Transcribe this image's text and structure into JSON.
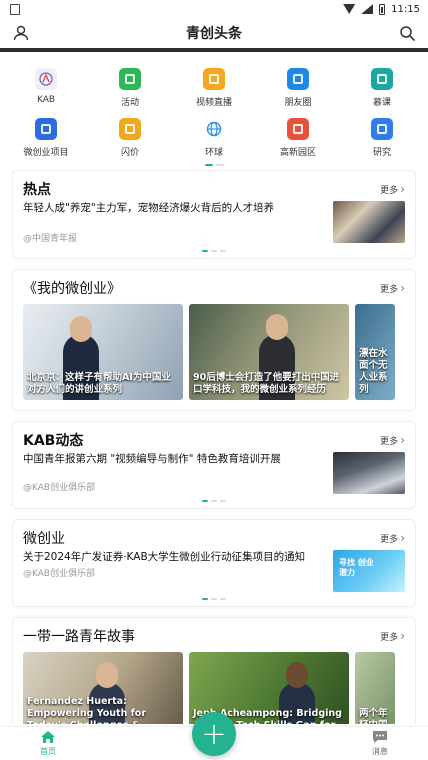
{
  "status": {
    "time": "11:15"
  },
  "header": {
    "title": "青创头条"
  },
  "grid": [
    {
      "label": "KAB",
      "icon": "kab-logo-icon",
      "color": "#f1eef8",
      "glyph": ""
    },
    {
      "label": "活动",
      "icon": "gift-icon",
      "color": "#2fb657",
      "glyph": ""
    },
    {
      "label": "视频直播",
      "icon": "video-camera-icon",
      "color": "#f6a623",
      "glyph": ""
    },
    {
      "label": "朋友圈",
      "icon": "pinwheel-icon",
      "color": "#1e88e5",
      "glyph": ""
    },
    {
      "label": "慕课",
      "icon": "mooc-screen-icon",
      "color": "#1da7a0",
      "glyph": ""
    },
    {
      "label": "微创业项目",
      "icon": "server-stack-icon",
      "color": "#2d6be0",
      "glyph": ""
    },
    {
      "label": "闪价",
      "icon": "money-bag-icon",
      "color": "#f0a81c",
      "glyph": ""
    },
    {
      "label": "环球",
      "icon": "globe-icon",
      "color": "#ffffff",
      "glyph": ""
    },
    {
      "label": "高新园区",
      "icon": "park-building-icon",
      "color": "#e5533c",
      "glyph": ""
    },
    {
      "label": "研究",
      "icon": "research-card-icon",
      "color": "#2f7de9",
      "glyph": ""
    }
  ],
  "sections": {
    "hot": {
      "title": "热点",
      "more": "更多",
      "news_title": "年轻人成\"养宠\"主力军，宠物经济爆火背后的人才培养",
      "source": "@中国青年报"
    },
    "my_startup": {
      "title": "《我的微创业》",
      "more": "更多",
      "tiles": [
        {
          "caption": "北京京：这样子有帮助AI为中国业对方人们的讲创业系列"
        },
        {
          "caption": "90后博士会打造了他要打出中国进口学科技，我的微创业系列经历"
        },
        {
          "caption": "漂在水面个无人业系列"
        }
      ]
    },
    "kab": {
      "title": "KAB动态",
      "more": "更多",
      "news_title": "中国青年报第六期 \"视频编导与制作\" 特色教育培训开展",
      "source": "@KAB创业俱乐部"
    },
    "micro": {
      "title": "微创业",
      "more": "更多",
      "news_title": "关于2024年广发证券·KAB大学生微创业行动征集项目的通知",
      "source": "@KAB创业俱乐部",
      "thumb_text": "寻找 创业潜力"
    },
    "belt_road": {
      "title": "一带一路青年故事",
      "more": "更多",
      "tiles": [
        {
          "caption": "Fernandez Huerta: Empowering Youth for Today's Challenges & Tomorrow's Leadership"
        },
        {
          "caption": "Jeph Acheampong: Bridging Africa's Tech Skills Gap for Young Africans"
        },
        {
          "caption": "两个年轻中国创业"
        }
      ]
    }
  },
  "bottom_nav": {
    "home": "首页",
    "messages": "消息",
    "fab": "+"
  }
}
